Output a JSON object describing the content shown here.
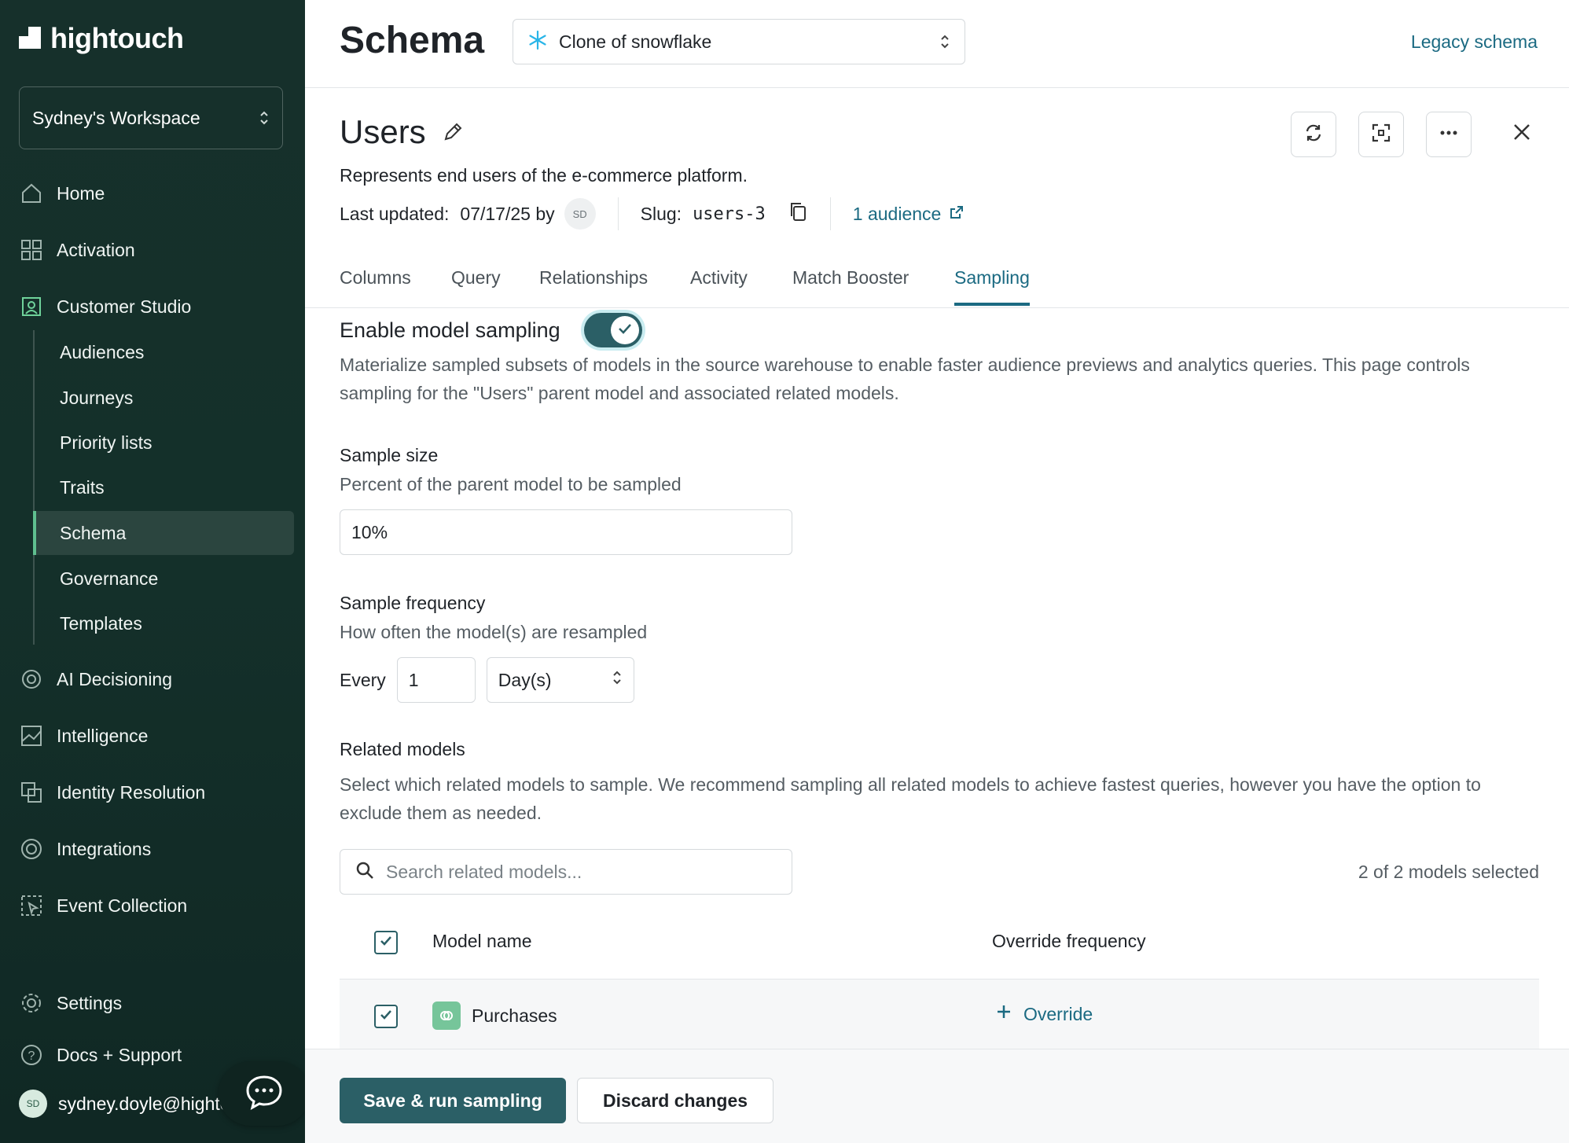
{
  "brand": {
    "name": "hightouch"
  },
  "workspace": {
    "name": "Sydney's Workspace"
  },
  "nav": {
    "home": "Home",
    "activation": "Activation",
    "customer_studio": "Customer Studio",
    "sub": [
      "Audiences",
      "Journeys",
      "Priority lists",
      "Traits",
      "Schema",
      "Governance",
      "Templates"
    ],
    "ai_decisioning": "AI Decisioning",
    "intelligence": "Intelligence",
    "identity_resolution": "Identity Resolution",
    "integrations": "Integrations",
    "event_collection": "Event Collection",
    "settings": "Settings",
    "docs": "Docs + Support"
  },
  "user": {
    "initials": "SD",
    "email": "sydney.doyle@hightouch.io"
  },
  "header": {
    "title": "Schema",
    "source": "Clone of snowflake",
    "legacy_link": "Legacy schema"
  },
  "model": {
    "name": "Users",
    "description": "Represents end users of the e-commerce platform.",
    "last_updated_label": "Last updated:",
    "last_updated_value": "07/17/25 by",
    "updated_by_initials": "SD",
    "slug_label": "Slug:",
    "slug": "users-3",
    "audience_link": "1 audience"
  },
  "tabs": [
    "Columns",
    "Query",
    "Relationships",
    "Activity",
    "Match Booster",
    "Sampling"
  ],
  "active_tab": "Sampling",
  "sampling": {
    "enable_label": "Enable model sampling",
    "enabled": true,
    "description": "Materialize sampled subsets of models in the source warehouse to enable faster audience previews and analytics queries. This page controls sampling for the \"Users\" parent model and associated related models.",
    "size_label": "Sample size",
    "size_help": "Percent of the parent model to be sampled",
    "size_value": "10%",
    "freq_label": "Sample frequency",
    "freq_help": "How often the model(s) are resampled",
    "every_label": "Every",
    "freq_value": "1",
    "freq_unit": "Day(s)",
    "related_label": "Related models",
    "related_help": "Select which related models to sample. We recommend sampling all related models to achieve fastest queries, however you have the option to exclude them as needed.",
    "search_placeholder": "Search related models...",
    "selected_count": "2 of 2 models selected",
    "col_model_name": "Model name",
    "col_override": "Override frequency",
    "rows": [
      {
        "name": "Purchases",
        "action": "Override"
      }
    ]
  },
  "footer": {
    "save": "Save & run sampling",
    "discard": "Discard changes"
  },
  "colors": {
    "sidebar_bg": "#16302b",
    "accent": "#1b6a82",
    "primary_button": "#2b5f66",
    "active_indicator": "#5fbf8f"
  }
}
